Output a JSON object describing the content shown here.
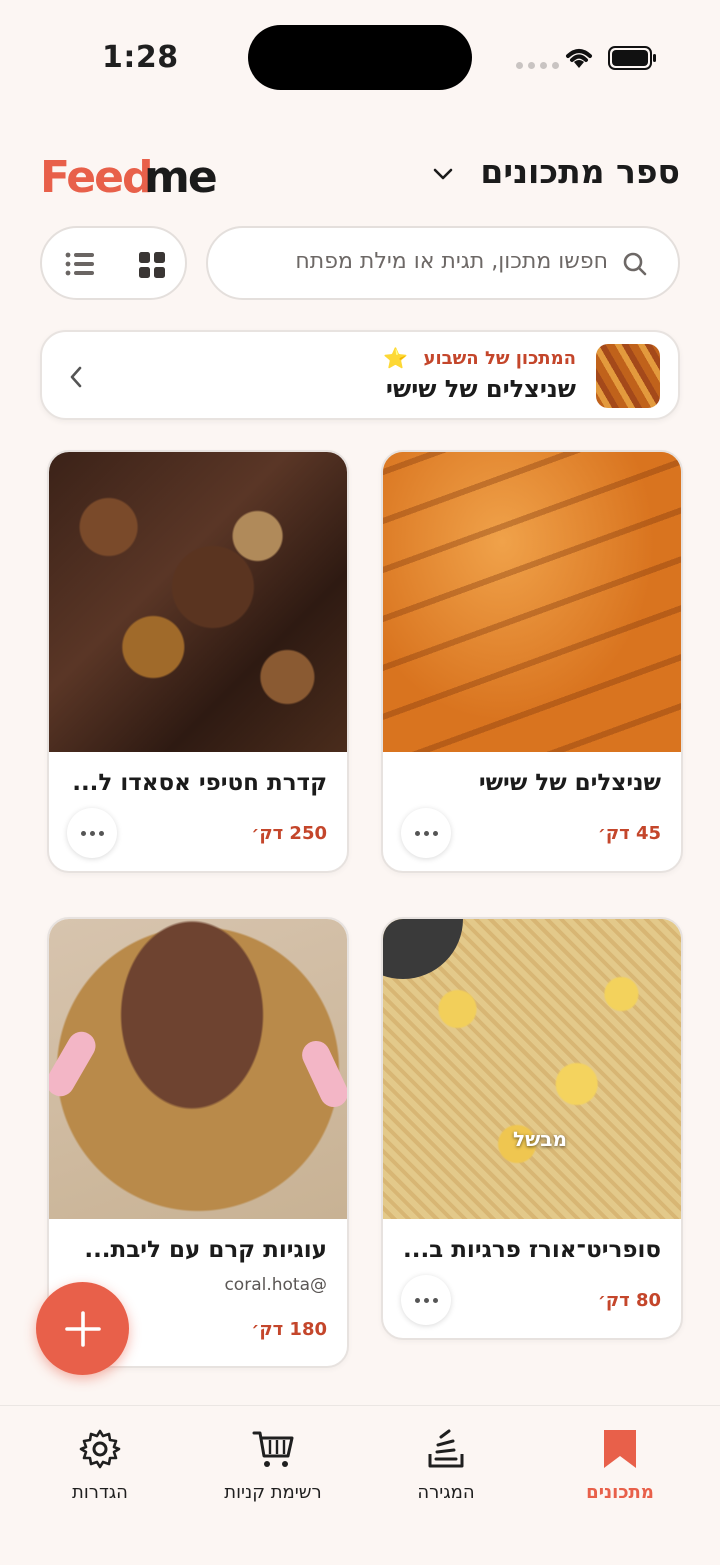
{
  "status_bar": {
    "time": "1:28"
  },
  "header": {
    "logo_text": "Feedme",
    "book_title": "ספר מתכונים",
    "logo_color": "#e8604a"
  },
  "search": {
    "placeholder": "חפשו מתכון, תגית או מילת מפתח",
    "icon": "search-icon"
  },
  "view_toggle": {
    "selected": "grid",
    "icons": [
      "list-icon",
      "grid-icon"
    ]
  },
  "recipe_of_week": {
    "label": "המתכון של השבוע",
    "name": "שניצלים של שישי",
    "star_icon": "⭐"
  },
  "recipes": [
    {
      "title": "שניצלים של שישי",
      "time": "45 דק׳",
      "author": ""
    },
    {
      "title": "קדרת חטיפי אסאדו ל...",
      "time": "250 דק׳",
      "author": ""
    },
    {
      "title": "סופריט־אורז פרגיות ב...",
      "time": "80 דק׳",
      "author": "",
      "overlay": "מבשל"
    },
    {
      "title": "עוגיות קרם עם ליבת...",
      "time": "180 דק׳",
      "author": "coral.hota@"
    }
  ],
  "bottom_nav": {
    "items": [
      {
        "label": "מתכונים",
        "icon": "bookmark-icon",
        "active": true
      },
      {
        "label": "המגירה",
        "icon": "drawer-icon",
        "active": false
      },
      {
        "label": "רשימת קניות",
        "icon": "cart-icon",
        "active": false
      },
      {
        "label": "הגדרות",
        "icon": "gear-icon",
        "active": false
      }
    ]
  },
  "colors": {
    "accent": "#e8604a",
    "time_text": "#c4462b",
    "background": "#fcf6f3"
  }
}
